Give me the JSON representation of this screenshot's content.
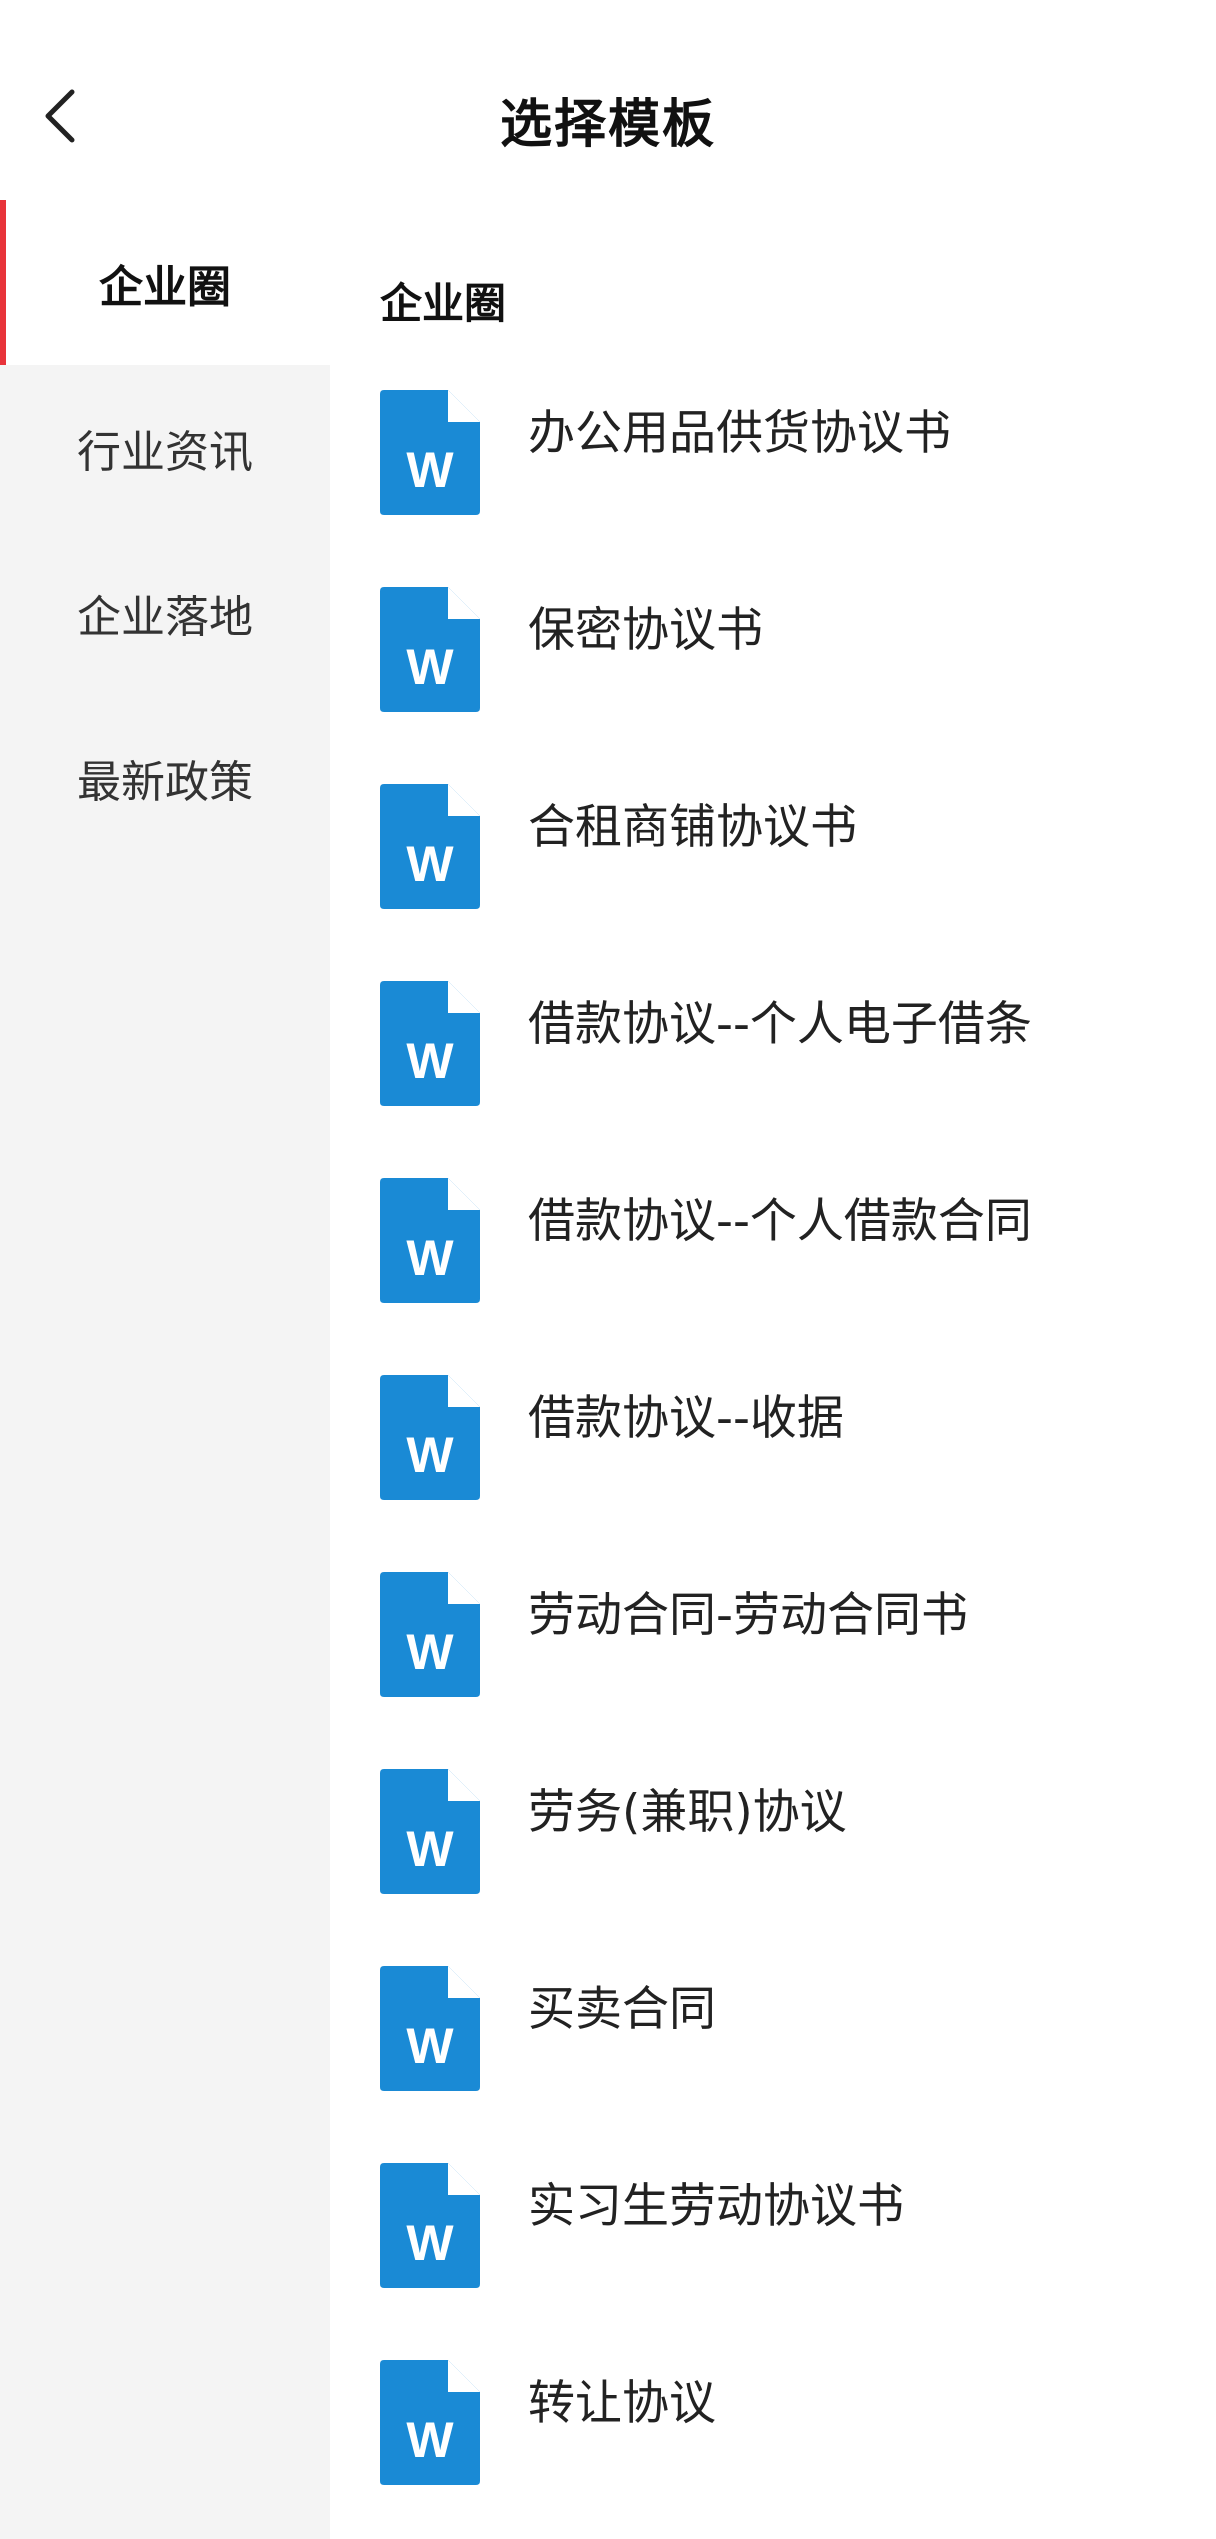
{
  "header": {
    "title": "选择模板",
    "back_icon": "chevron-left-icon"
  },
  "colors": {
    "accent": "#e8333a",
    "doc_icon_blue": "#1a8ad5",
    "sidebar_bg": "#f4f4f4"
  },
  "sidebar": {
    "items": [
      {
        "label": "企业圈",
        "active": true
      },
      {
        "label": "行业资讯",
        "active": false
      },
      {
        "label": "企业落地",
        "active": false
      },
      {
        "label": "最新政策",
        "active": false
      }
    ]
  },
  "content": {
    "section_title": "企业圈",
    "doc_icon_letter": "W",
    "documents": [
      {
        "name": "办公用品供货协议书"
      },
      {
        "name": "保密协议书"
      },
      {
        "name": "合租商铺协议书"
      },
      {
        "name": "借款协议--个人电子借条"
      },
      {
        "name": "借款协议--个人借款合同"
      },
      {
        "name": "借款协议--收据"
      },
      {
        "name": "劳动合同-劳动合同书"
      },
      {
        "name": "劳务(兼职)协议"
      },
      {
        "name": "买卖合同"
      },
      {
        "name": "实习生劳动协议书"
      },
      {
        "name": "转让协议"
      }
    ]
  }
}
